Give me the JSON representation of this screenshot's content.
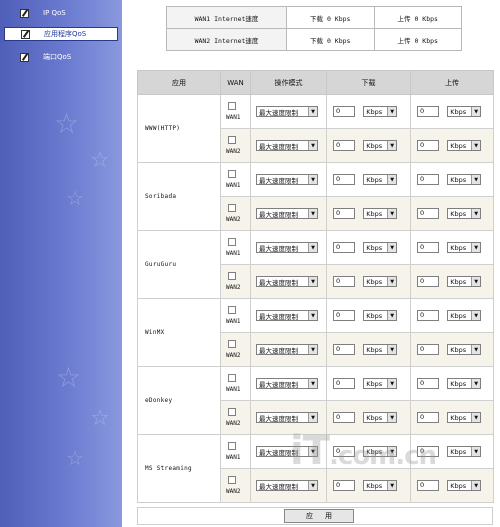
{
  "sidebar": {
    "items": [
      {
        "label": "IP QoS",
        "icon": "edit-icon",
        "active": false
      },
      {
        "label": "应用程序QoS",
        "icon": "edit-icon",
        "active": true
      },
      {
        "label": "端口QoS",
        "icon": "edit-icon",
        "active": false
      }
    ]
  },
  "status": {
    "rows": [
      {
        "label": "WAN1 Internet速度",
        "down": "下载 0 Kbps",
        "up": "上传 0 Kbps"
      },
      {
        "label": "WAN2 Internet速度",
        "down": "下载 0 Kbps",
        "up": "上传 0 Kbps"
      }
    ]
  },
  "table": {
    "headers": {
      "app": "应用",
      "wan": "WAN",
      "mode": "操作模式",
      "down": "下载",
      "up": "上传"
    },
    "apps": [
      {
        "name": "WWW(HTTP)"
      },
      {
        "name": "Soribada"
      },
      {
        "name": "GuruGuru"
      },
      {
        "name": "WinMX"
      },
      {
        "name": "eDonkey"
      },
      {
        "name": "MS Streaming"
      }
    ],
    "wan1_label": "WAN1",
    "wan2_label": "WAN2",
    "mode_value": "最大速度限制",
    "num_value": "0",
    "unit_value": "Kbps"
  },
  "apply_label": "应用",
  "watermark": "iT.com.cn",
  "colors": {
    "sidebar": "#5f6fc6",
    "header_bg": "#d6d6d6",
    "wan2_row_bg": "#f6f3ea"
  }
}
